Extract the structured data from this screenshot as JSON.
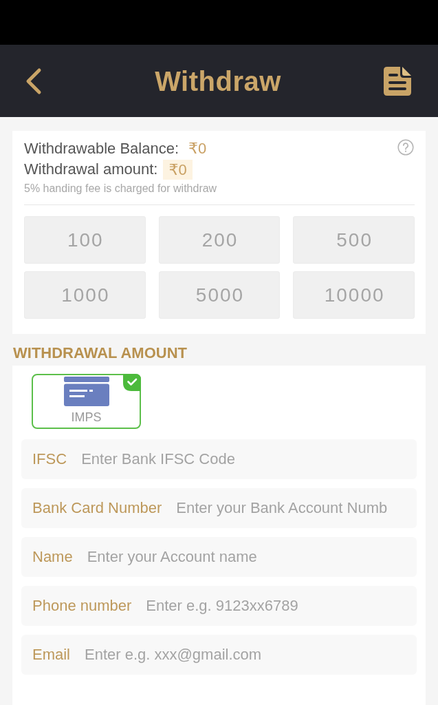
{
  "header": {
    "title": "Withdraw"
  },
  "balance_card": {
    "balance_label": "Withdrawable Balance:",
    "balance_value": "₹0",
    "amount_label": "Withdrawal amount:",
    "amount_value": "₹0",
    "fee_note": "5% handing fee is charged for withdraw",
    "amount_options": [
      {
        "label": "100",
        "selected": false
      },
      {
        "label": "200",
        "selected": false
      },
      {
        "label": "500",
        "selected": false
      },
      {
        "label": "1000",
        "selected": false
      },
      {
        "label": "5000",
        "selected": false
      },
      {
        "label": "10000",
        "selected": false
      }
    ]
  },
  "section_title": "WITHDRAWAL AMOUNT",
  "methods": [
    {
      "label": "IMPS",
      "selected": true
    }
  ],
  "fields": [
    {
      "label": "IFSC",
      "placeholder": "Enter Bank IFSC Code"
    },
    {
      "label": "Bank Card Number",
      "placeholder": "Enter your Bank Account Numb"
    },
    {
      "label": "Name",
      "placeholder": "Enter your Account name"
    },
    {
      "label": "Phone number",
      "placeholder": "Enter e.g. 9123xx6789"
    },
    {
      "label": "Email",
      "placeholder": "Enter e.g. xxx@gmail.com"
    }
  ]
}
